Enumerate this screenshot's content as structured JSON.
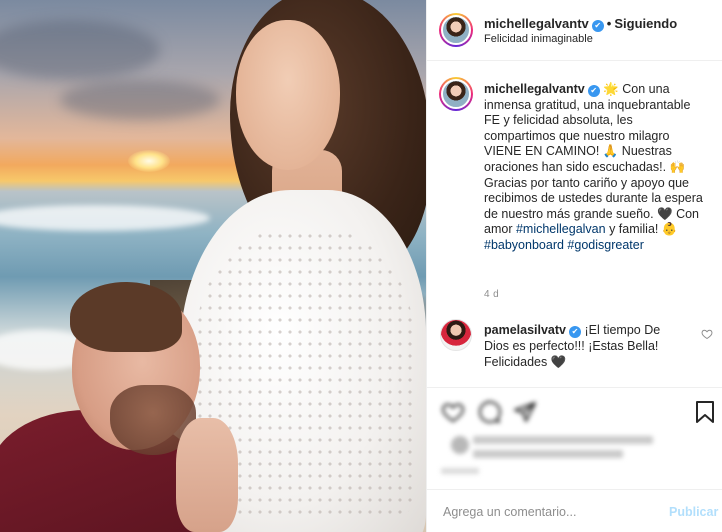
{
  "post": {
    "author": "michellegalvantv",
    "follow_status": "Siguiendo",
    "follow_separator": "•",
    "location": "Felicidad inimaginable",
    "verified_mark": "✔"
  },
  "caption": {
    "username": "michellegalvantv",
    "text_part1": " 🌟 Con una inmensa gratitud, una inquebrantable FE y felicidad absoluta, les compartimos que nuestro milagro VIENE EN CAMINO! 🙏 Nuestras oraciones han sido escuchadas!. 🙌 Gracias por tanto cariño y apoyo que recibimos de ustedes durante la espera de nuestro más grande sueño. 🖤 Con amor ",
    "tag1": "#michellegalvan",
    "text_part2": " y familia! 👶 ",
    "tag2": "#babyonboard",
    "tag3": "#godisgreater",
    "time_ago": "4 d"
  },
  "comments": [
    {
      "username": "pamelasilvatv",
      "text": " ¡El tiempo De Dios es perfecto!!! ¡Estas Bella! Felicidades 🖤"
    }
  ],
  "add_comment": {
    "placeholder": "Agrega un comentario...",
    "publish_label": "Publicar"
  },
  "icons": {
    "like": "heart-icon",
    "comment": "comment-icon",
    "share": "share-icon",
    "save": "bookmark-icon",
    "comment_like": "heart-outline-icon"
  },
  "colors": {
    "verified_blue": "#3897f0",
    "hashtag": "#00376b",
    "muted": "#8e8e8e",
    "publish_disabled": "#b2dffc"
  }
}
